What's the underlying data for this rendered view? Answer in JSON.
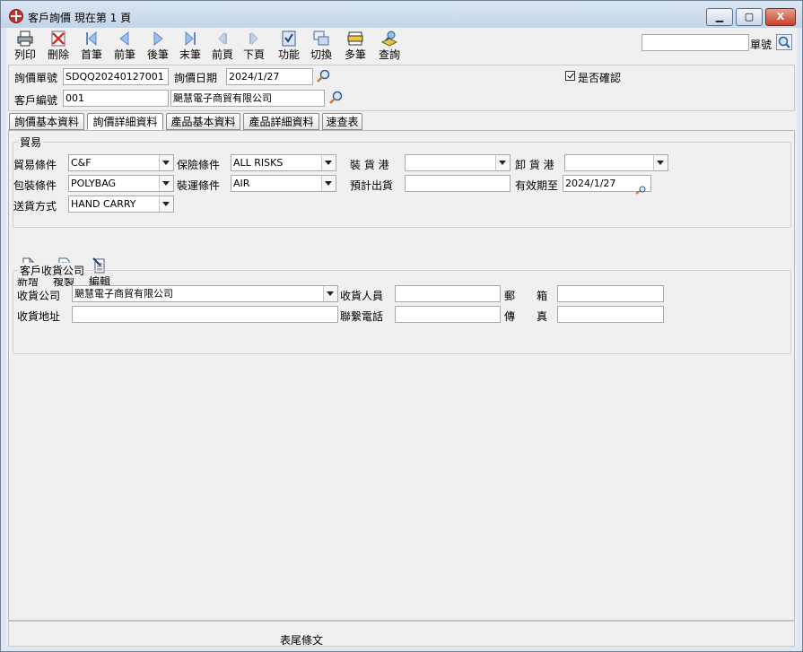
{
  "window": {
    "title": "客戶詢價  現在第 1 頁",
    "min_label": "▁",
    "max_label": "▢",
    "close_label": "X"
  },
  "toolbar": {
    "items": [
      {
        "name": "print",
        "label": "列印",
        "icon": "printer-icon"
      },
      {
        "name": "delete",
        "label": "刪除",
        "icon": "delete-icon"
      },
      {
        "name": "first",
        "label": "首筆",
        "icon": "first-record-icon"
      },
      {
        "name": "prev",
        "label": "前筆",
        "icon": "prev-record-icon"
      },
      {
        "name": "next",
        "label": "後筆",
        "icon": "next-record-icon"
      },
      {
        "name": "last",
        "label": "末筆",
        "icon": "last-record-icon"
      },
      {
        "name": "prev-page",
        "label": "前頁",
        "icon": "prev-page-icon"
      },
      {
        "name": "next-page",
        "label": "下頁",
        "icon": "next-page-icon"
      },
      {
        "name": "function",
        "label": "功能",
        "icon": "function-icon"
      },
      {
        "name": "switch",
        "label": "切換",
        "icon": "switch-icon"
      },
      {
        "name": "multi",
        "label": "多筆",
        "icon": "multi-record-icon"
      },
      {
        "name": "query",
        "label": "查詢",
        "icon": "query-icon"
      }
    ],
    "search_value": "",
    "search_label": "單號"
  },
  "header": {
    "quote_no_label": "詢價單號",
    "quote_no": "SDQQ20240127001",
    "quote_date_label": "詢價日期",
    "quote_date": "2024/1/27",
    "confirmed_label": "是否確認",
    "customer_no_label": "客戶編號",
    "customer_no": "001",
    "customer_name": "颶慧電子商貿有限公司"
  },
  "tabs": [
    {
      "label": "詢價基本資料"
    },
    {
      "label": "詢價詳細資料"
    },
    {
      "label": "產品基本資料"
    },
    {
      "label": "產品詳細資料"
    },
    {
      "label": "速查表"
    }
  ],
  "trade": {
    "group_title": "貿易",
    "trade_terms_label": "貿易條件",
    "trade_terms": "C&F",
    "insurance_label": "保險條件",
    "insurance": "ALL RISKS",
    "load_port_label": "裝 貨 港",
    "load_port": "",
    "unload_port_label": "卸 貨 港",
    "unload_port": "",
    "packing_label": "包裝條件",
    "packing": "POLYBAG",
    "shipping_label": "裝運條件",
    "shipping": "AIR",
    "est_ship_label": "預計出貨",
    "est_ship": "",
    "valid_until_label": "有效期至",
    "valid_until": "2024/1/27",
    "delivery_label": "送貨方式",
    "delivery": "HAND CARRY"
  },
  "actions": {
    "add": "新增",
    "copy": "複製",
    "edit": "編輯"
  },
  "consignee": {
    "group_title": "客戶收貨公司",
    "company_label": "收貨公司",
    "company": "颶慧電子商貿有限公司",
    "receiver_label": "收貨人員",
    "receiver": "",
    "mailbox_label": "郵　　箱",
    "mailbox": "",
    "address_label": "收貨地址",
    "address": "",
    "phone_label": "聯繫電話",
    "phone": "",
    "fax_label": "傳　　真",
    "fax": ""
  },
  "footer": {
    "text": "表尾條文"
  }
}
